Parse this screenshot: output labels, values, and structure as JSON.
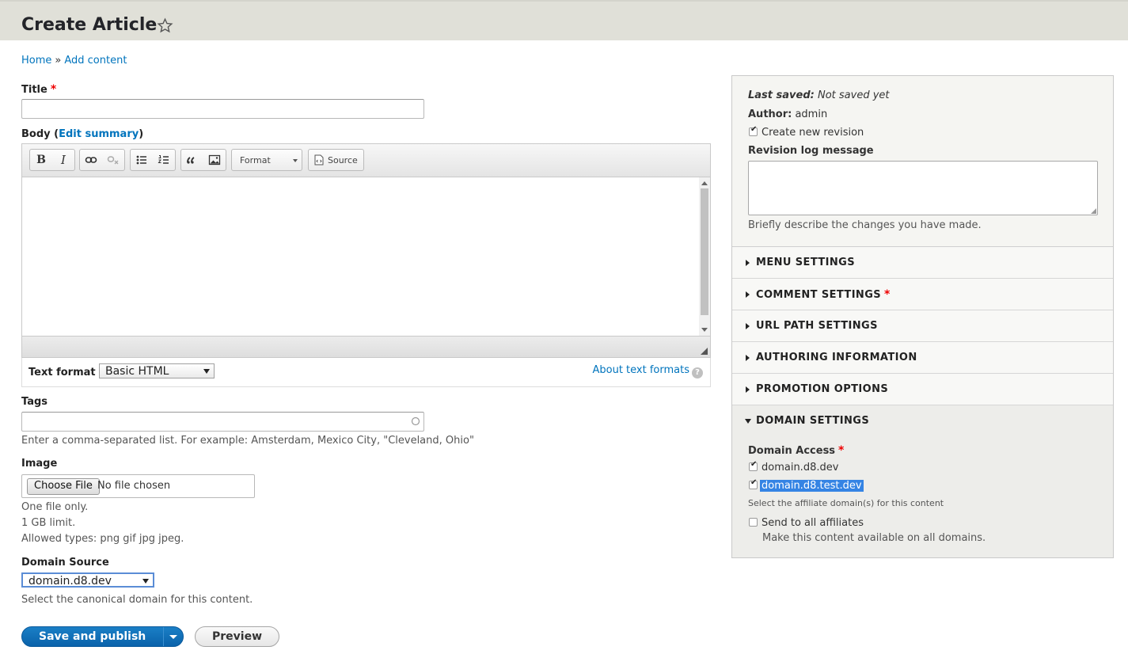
{
  "page": {
    "title": "Create Article",
    "breadcrumb": [
      {
        "label": "Home"
      },
      {
        "label": "Add content"
      }
    ],
    "breadcrumb_sep": "»"
  },
  "form": {
    "title_label": "Title",
    "title_value": "",
    "required_mark": "*",
    "body_label": "Body (",
    "body_edit_summary": "Edit summary",
    "body_label_close": ")",
    "toolbar": {
      "bold": "B",
      "italic": "I",
      "format": "Format",
      "source": "Source"
    },
    "text_format_label": "Text format",
    "text_format_value": "Basic HTML",
    "about_text_formats": "About text formats",
    "help_glyph": "?",
    "tags_label": "Tags",
    "tags_value": "",
    "tags_help": "Enter a comma-separated list. For example: Amsterdam, Mexico City, \"Cleveland, Ohio\"",
    "image_label": "Image",
    "choose_file": "Choose File",
    "no_file": "No file chosen",
    "image_help": [
      "One file only.",
      "1 GB limit.",
      "Allowed types: png gif jpg jpeg."
    ],
    "domain_source_label": "Domain Source",
    "domain_source_value": "domain.d8.dev",
    "domain_source_help": "Select the canonical domain for this content.",
    "save_label": "Save and publish",
    "preview_label": "Preview"
  },
  "sidebar": {
    "last_saved_label": "Last saved:",
    "last_saved_value": "Not saved yet",
    "author_label": "Author:",
    "author_value": "admin",
    "create_revision_label": "Create new revision",
    "create_revision_checked": true,
    "revision_log_label": "Revision log message",
    "revision_log_value": "",
    "revision_log_help": "Briefly describe the changes you have made.",
    "sections": [
      {
        "label": "MENU SETTINGS"
      },
      {
        "label": "COMMENT SETTINGS"
      },
      {
        "label": "URL PATH SETTINGS"
      },
      {
        "label": "AUTHORING INFORMATION"
      },
      {
        "label": "PROMOTION OPTIONS"
      }
    ],
    "domain_settings": {
      "title": "DOMAIN SETTINGS",
      "access_label": "Domain Access",
      "domains": [
        {
          "label": "domain.d8.dev",
          "checked": true
        },
        {
          "label": "domain.d8.test.dev",
          "checked": true
        }
      ],
      "access_help": "Select the affiliate domain(s) for this content",
      "send_all_label": "Send to all affiliates",
      "send_all_checked": false,
      "send_all_help": "Make this content available on all domains."
    }
  }
}
